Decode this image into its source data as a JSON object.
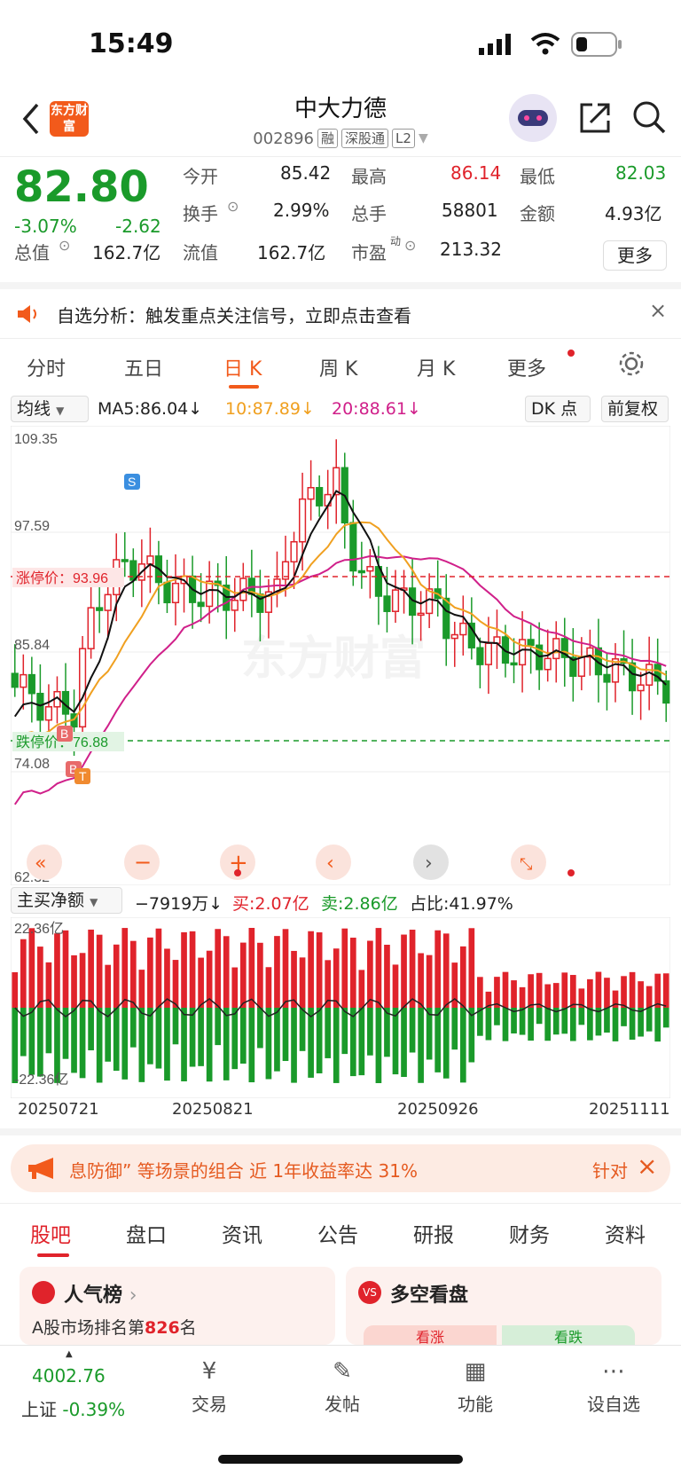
{
  "status": {
    "time": "15:49"
  },
  "header": {
    "logo_text": "东方财富",
    "title": "中大力德",
    "code": "002896",
    "tags": [
      "融",
      "深股通",
      "L2"
    ]
  },
  "quote": {
    "price": "82.80",
    "change_pct": "-3.07%",
    "change": "-2.62",
    "open_label": "今开",
    "open": "85.42",
    "high_label": "最高",
    "high": "86.14",
    "low_label": "最低",
    "low": "82.03",
    "turnover_label": "换手",
    "turnover": "2.99%",
    "volume_label": "总手",
    "volume": "58801",
    "amount_label": "金额",
    "amount": "4.93亿",
    "mcap_label": "总值",
    "mcap": "162.7亿",
    "float_label": "流值",
    "float": "162.7亿",
    "pe_label": "市盈",
    "pe_sup": "动",
    "pe": "213.32",
    "more": "更多"
  },
  "notice": {
    "text": "自选分析：触发重点关注信号，立即点击查看"
  },
  "tabs": [
    "分时",
    "五日",
    "日 K",
    "周 K",
    "月 K",
    "更多"
  ],
  "active_tab": "日 K",
  "ma": {
    "selector": "均线",
    "ma5": "MA5:86.04",
    "ma10": "10:87.89",
    "ma20": "20:88.61",
    "dk": "DK 点",
    "fq": "前复权"
  },
  "kchart": {
    "y_labels": [
      "109.35",
      "97.59",
      "85.84",
      "74.08",
      "62.32"
    ],
    "limit_up": "涨停价：93.96",
    "limit_down": "跌停价：76.88",
    "watermark": "东方财富",
    "markers": [
      "S",
      "B",
      "B",
      "T"
    ]
  },
  "vol": {
    "selector": "主买净额",
    "net": "−7919万",
    "buy": "买:2.07亿",
    "sell": "卖:2.86亿",
    "ratio": "占比:41.97%",
    "ymax": "22.36亿",
    "ymin": "-22.36亿"
  },
  "dates": [
    "20250721",
    "20250821",
    "20250926",
    "20251111"
  ],
  "banner": {
    "text": "息防御” 等场景的组合 近 1年收益率达 31%",
    "right": "针对"
  },
  "content_tabs": [
    "股吧",
    "盘口",
    "资讯",
    "公告",
    "研报",
    "财务",
    "资料"
  ],
  "cards": {
    "popular_title": "人气榜",
    "popular_sub_prefix": "A股市场排名第",
    "popular_rank": "826",
    "popular_sub_suffix": "名",
    "duokong_title": "多空看盘",
    "rise": "看涨",
    "fall": "看跌"
  },
  "bottom": {
    "index_value": "4002.76",
    "index_label": "上证",
    "index_change": "-0.39%",
    "items": [
      "交易",
      "发帖",
      "功能",
      "设自选"
    ]
  },
  "colors": {
    "accent": "#f25a1b",
    "up": "#e0232b",
    "down": "#1a9a2a",
    "ma10": "#f0a020",
    "ma20": "#d0208a"
  }
}
